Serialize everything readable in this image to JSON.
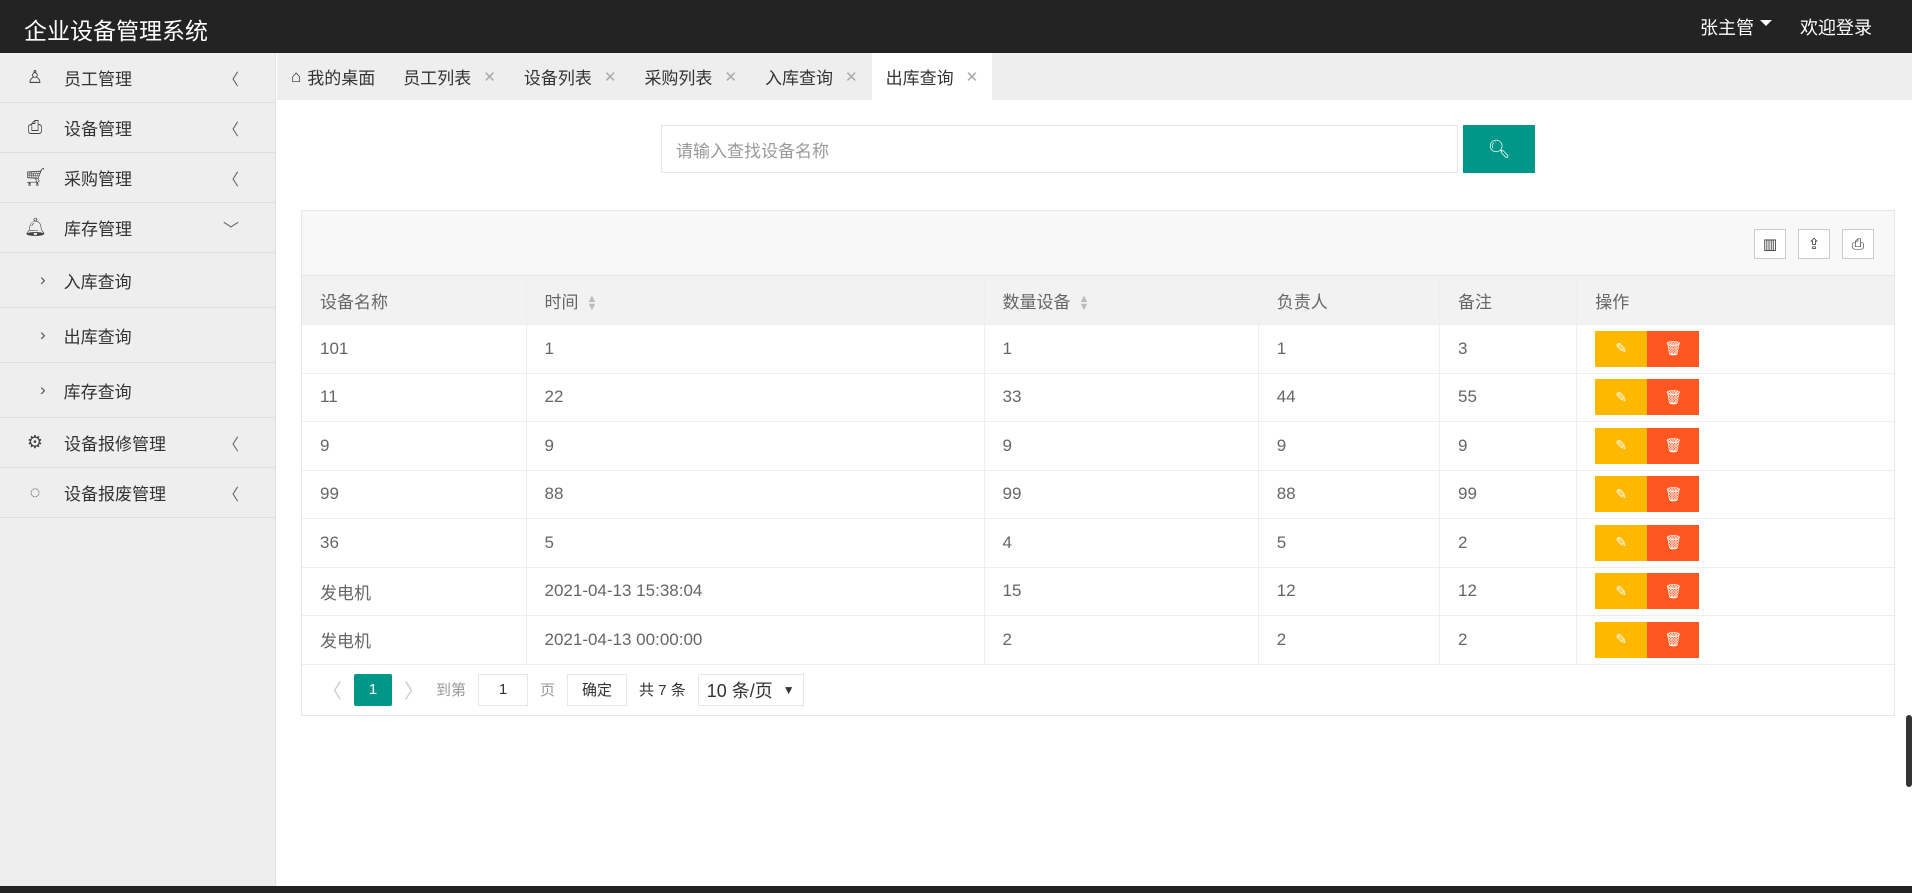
{
  "header": {
    "title": "企业设备管理系统",
    "user": "张主管",
    "welcome": "欢迎登录"
  },
  "sidebar": {
    "items": [
      {
        "label": "员工管理",
        "icon": "user-icon"
      },
      {
        "label": "设备管理",
        "icon": "printer-icon"
      },
      {
        "label": "采购管理",
        "icon": "cart-icon"
      },
      {
        "label": "库存管理",
        "icon": "bell-icon",
        "sub": [
          "入库查询",
          "出库查询",
          "库存查询"
        ]
      },
      {
        "label": "设备报修管理",
        "icon": "gear-icon"
      },
      {
        "label": "设备报废管理",
        "icon": "circle-icon"
      }
    ]
  },
  "tabs": [
    {
      "label": "我的桌面"
    },
    {
      "label": "员工列表"
    },
    {
      "label": "设备列表"
    },
    {
      "label": "采购列表"
    },
    {
      "label": "入库查询"
    },
    {
      "label": "出库查询"
    }
  ],
  "search": {
    "placeholder": "请输入查找设备名称"
  },
  "table": {
    "headers": [
      "设备名称",
      "时间",
      "数量设备",
      "负责人",
      "备注",
      "操作"
    ],
    "rows": [
      [
        "101",
        "1",
        "1",
        "1",
        "3"
      ],
      [
        "11",
        "22",
        "33",
        "44",
        "55"
      ],
      [
        "9",
        "9",
        "9",
        "9",
        "9"
      ],
      [
        "99",
        "88",
        "99",
        "88",
        "99"
      ],
      [
        "36",
        "5",
        "4",
        "5",
        "2"
      ],
      [
        "发电机",
        "2021-04-13 15:38:04",
        "15",
        "12",
        "12"
      ],
      [
        "发电机",
        "2021-04-13 00:00:00",
        "2",
        "2",
        "2"
      ]
    ]
  },
  "pager": {
    "current": "1",
    "goto": "到第",
    "page_value": "1",
    "page_unit": "页",
    "confirm": "确定",
    "total": "共 7 条",
    "size": "10 条/页"
  },
  "colors": {
    "primary": "#009688",
    "edit": "#ffb800",
    "delete": "#ff5722"
  }
}
